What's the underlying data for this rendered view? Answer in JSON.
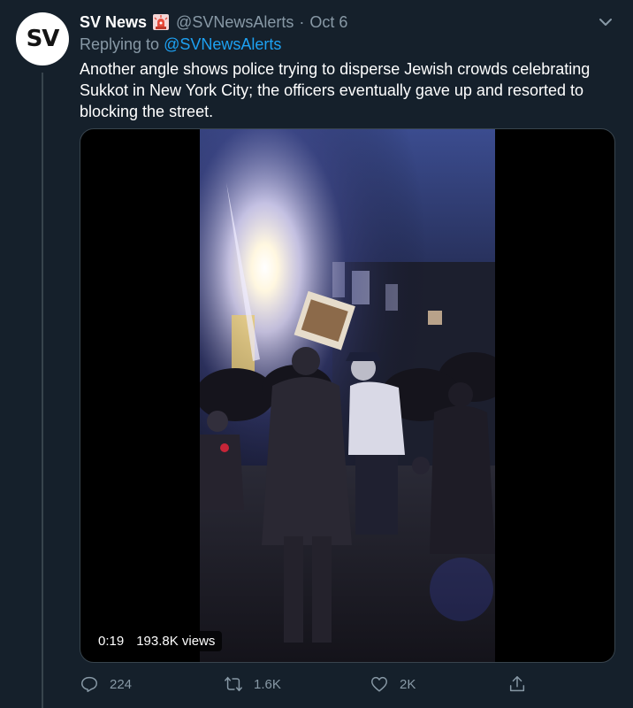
{
  "tweet": {
    "avatar": {
      "text": "SV"
    },
    "display_name": "SV News",
    "badge_icon": "police-siren-icon",
    "handle": "@SVNewsAlerts",
    "separator": "·",
    "date": "Oct 6",
    "replying_prefix": "Replying to",
    "replying_handle": "@SVNewsAlerts",
    "body": "Another angle shows police trying to disperse Jewish crowds celebrating Sukkot in New York City; the officers eventually gave up and resorted to blocking the street.",
    "media": {
      "type": "video",
      "duration": "0:19",
      "views": "193.8K views"
    },
    "actions": {
      "reply_count": "224",
      "retweet_count": "1.6K",
      "like_count": "2K"
    }
  },
  "colors": {
    "background": "#15202b",
    "text_primary": "#ffffff",
    "text_secondary": "#8899a6",
    "link": "#1da1f2",
    "border": "#38444d",
    "siren": "#e0245e"
  }
}
